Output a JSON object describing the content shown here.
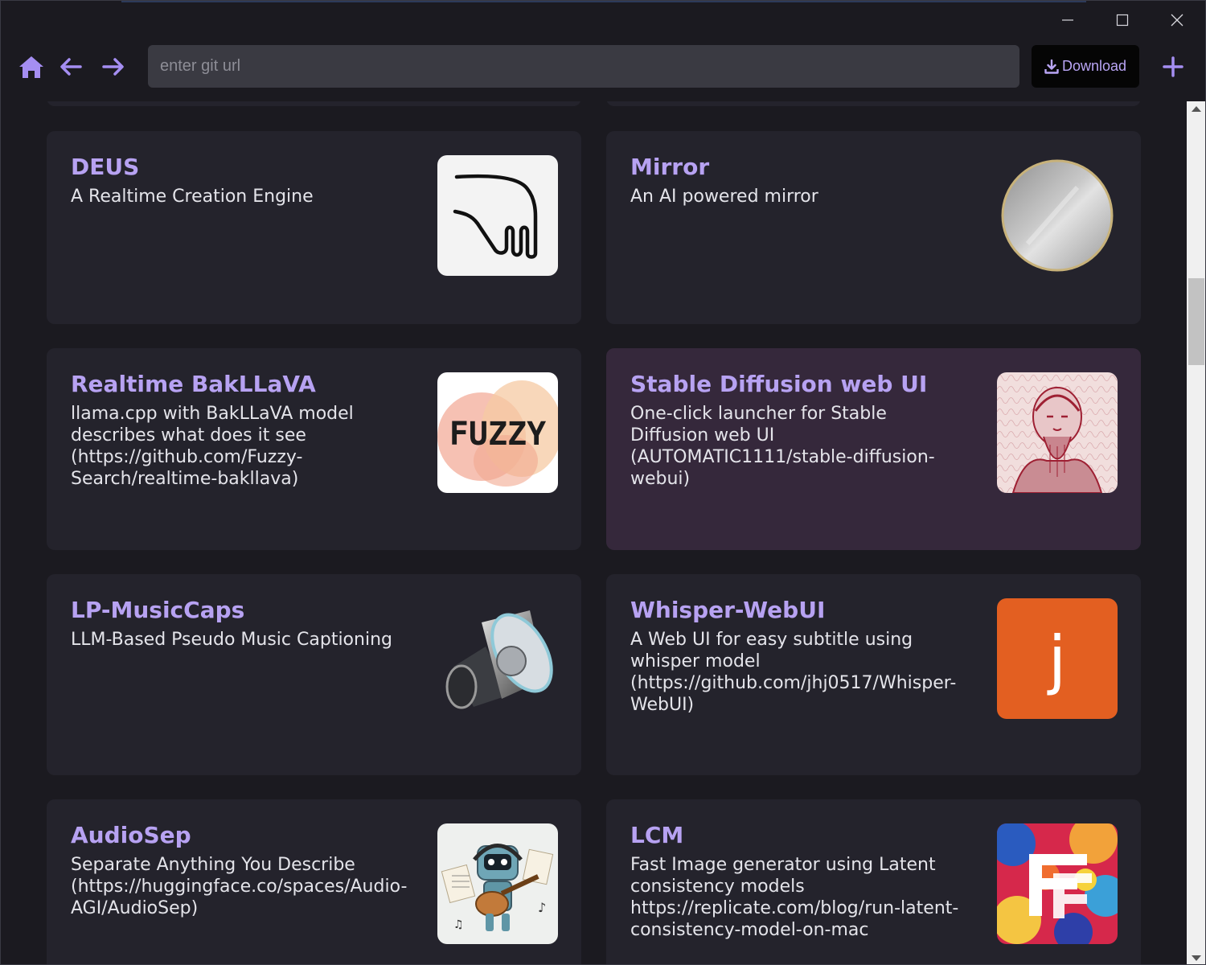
{
  "window": {
    "controls": {
      "minimize_icon": "minimize-icon",
      "maximize_icon": "maximize-icon",
      "close_icon": "close-icon"
    }
  },
  "toolbar": {
    "url_placeholder": "enter git url",
    "url_value": "",
    "download_label": "Download",
    "accent_color": "#a58ef2"
  },
  "cards": [
    {
      "title": "DEUS",
      "description": "A Realtime Creation Engine",
      "icon": "hand-sketch-logo"
    },
    {
      "title": "Mirror",
      "description": "An AI powered mirror",
      "icon": "round-mirror"
    },
    {
      "title": "Realtime BakLLaVA",
      "description": "llama.cpp with BakLLaVA model describes what does it see (https://github.com/Fuzzy-Search/realtime-bakllava)",
      "icon": "fuzzy-logo",
      "logo_text": "FUZZY"
    },
    {
      "title": "Stable Diffusion web UI",
      "description": "One-click launcher for Stable Diffusion web UI (AUTOMATIC1111/stable-diffusion-webui)",
      "icon": "engraved-portrait",
      "selected": true
    },
    {
      "title": "LP-MusicCaps",
      "description": "LLM-Based Pseudo Music Captioning",
      "icon": "speaker"
    },
    {
      "title": "Whisper-WebUI",
      "description": "A Web UI for easy subtitle using whisper model (https://github.com/jhj0517/Whisper-WebUI)",
      "icon": "letter-j-logo",
      "logo_text": "j"
    },
    {
      "title": "AudioSep",
      "description": "Separate Anything You Describe (https://huggingface.co/spaces/Audio-AGI/AudioSep)",
      "icon": "robot-guitar"
    },
    {
      "title": "LCM",
      "description": "Fast Image generator using Latent consistency models https://replicate.com/blog/run-latent-consistency-model-on-mac",
      "icon": "colorful-f-logo"
    }
  ]
}
